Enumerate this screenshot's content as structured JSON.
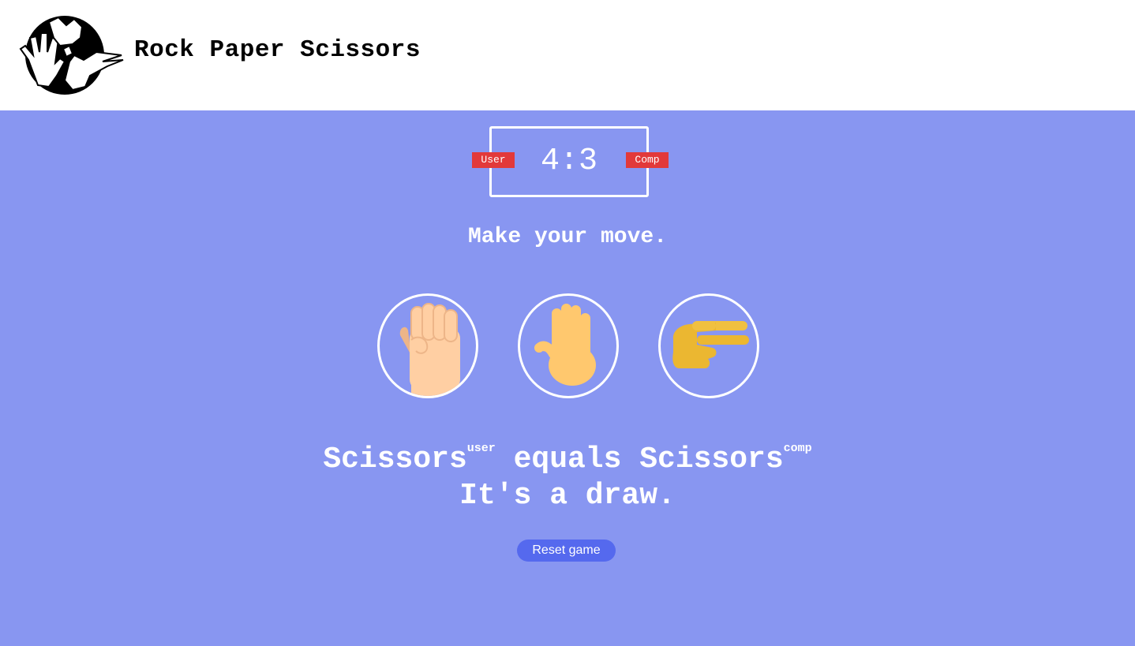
{
  "header": {
    "title": "Rock Paper Scissors",
    "logo_icon": "rock-paper-scissors-hands-logo"
  },
  "scoreboard": {
    "user_label": "User",
    "comp_label": "Comp",
    "user_score": 4,
    "comp_score": 3,
    "separator": ":",
    "score_text": "4:3",
    "badge_color": "#e2393a"
  },
  "prompt": "Make your move.",
  "choices": [
    {
      "name": "Rock",
      "icon": "fist-icon"
    },
    {
      "name": "Paper",
      "icon": "raised-hand-icon"
    },
    {
      "name": "Scissors",
      "icon": "two-fingers-hand-icon"
    }
  ],
  "result": {
    "user_choice": "Scissors",
    "user_tag": "user",
    "verb": " equals ",
    "comp_choice": "Scissors",
    "comp_tag": "comp",
    "outcome": "It's a draw."
  },
  "reset_label": "Reset game",
  "colors": {
    "background": "#8896f1",
    "header": "#ffffff",
    "button": "#5569ee",
    "text": "#ffffff"
  }
}
